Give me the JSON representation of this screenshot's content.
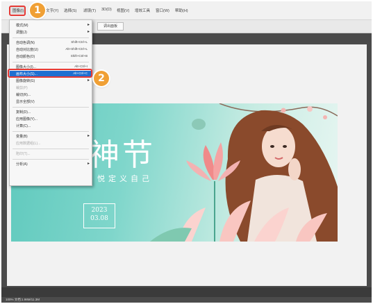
{
  "menubar": {
    "items": [
      "图像(I)",
      "文字(Y)",
      "选择(S)",
      "滤镜(T)",
      "3D(D)",
      "视图(V)",
      "增效工具",
      "窗口(W)",
      "帮助(H)"
    ]
  },
  "options_bar": {
    "button_label": "调出面板"
  },
  "dropdown": {
    "items": [
      {
        "label": "模式(M)",
        "shortcut": "",
        "submenu": true,
        "disabled": false
      },
      {
        "label": "调整(J)",
        "shortcut": "",
        "submenu": true,
        "disabled": false
      },
      {
        "label": "自动色调(N)",
        "shortcut": "Shift+Ctrl+L",
        "submenu": false,
        "disabled": false
      },
      {
        "label": "自动对比度(U)",
        "shortcut": "Alt+Shift+Ctrl+L",
        "submenu": false,
        "disabled": false
      },
      {
        "label": "自动颜色(O)",
        "shortcut": "Shift+Ctrl+B",
        "submenu": false,
        "disabled": false
      },
      {
        "label": "图像大小(I)...",
        "shortcut": "Alt+Ctrl+I",
        "submenu": false,
        "disabled": false
      },
      {
        "label": "画布大小(S)...",
        "shortcut": "Alt+Ctrl+C",
        "submenu": false,
        "disabled": false,
        "selected": true
      },
      {
        "label": "图像旋转(G)",
        "shortcut": "",
        "submenu": true,
        "disabled": false
      },
      {
        "label": "裁剪(P)",
        "shortcut": "",
        "submenu": false,
        "disabled": true
      },
      {
        "label": "裁切(R)...",
        "shortcut": "",
        "submenu": false,
        "disabled": false
      },
      {
        "label": "显示全部(V)",
        "shortcut": "",
        "submenu": false,
        "disabled": false
      },
      {
        "label": "复制(D)...",
        "shortcut": "",
        "submenu": false,
        "disabled": false
      },
      {
        "label": "应用图像(Y)...",
        "shortcut": "",
        "submenu": false,
        "disabled": false
      },
      {
        "label": "计算(C)...",
        "shortcut": "",
        "submenu": false,
        "disabled": false
      },
      {
        "label": "变量(B)",
        "shortcut": "",
        "submenu": true,
        "disabled": false
      },
      {
        "label": "应用数据组(L)...",
        "shortcut": "",
        "submenu": false,
        "disabled": true
      },
      {
        "label": "陷印(T)...",
        "shortcut": "",
        "submenu": false,
        "disabled": true
      },
      {
        "label": "分析(A)",
        "shortcut": "",
        "submenu": true,
        "disabled": false
      }
    ]
  },
  "annotations": {
    "step1": "1",
    "step2": "2"
  },
  "canvas": {
    "title": "神节",
    "subtitle": "悦定义自己",
    "date_year": "2023",
    "date_day": "03.08"
  },
  "status": {
    "text": "100% 文档:1.98M/11.3M"
  },
  "colors": {
    "highlight": "#e53935",
    "badge": "#f0a035",
    "selected_row": "#1f6fd1",
    "canvas_teal": "#5fc9bd"
  }
}
